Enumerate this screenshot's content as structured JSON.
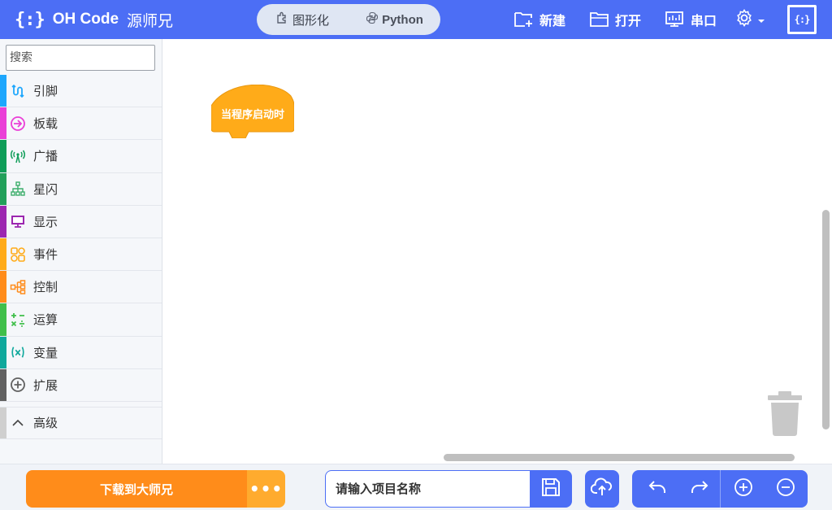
{
  "brand": {
    "icon_text": "{:}",
    "name": "OH Code",
    "name_cn": "源师兄"
  },
  "mode_tabs": [
    {
      "label": "图形化",
      "icon": "puzzle-icon"
    },
    {
      "label": "Python",
      "icon": "python-icon"
    }
  ],
  "top_actions": {
    "new": {
      "label": "新建",
      "icon": "new-file-icon"
    },
    "open": {
      "label": "打开",
      "icon": "folder-icon"
    },
    "serial": {
      "label": "串口",
      "icon": "serial-monitor-icon"
    },
    "settings": {
      "icon": "gear-icon"
    }
  },
  "sidebar": {
    "search": {
      "placeholder": "搜索",
      "value": ""
    },
    "categories": [
      {
        "label": "引脚",
        "color": "#1ea7fd",
        "icon": "pin-icon"
      },
      {
        "label": "板载",
        "color": "#ea3fd7",
        "icon": "board-icon"
      },
      {
        "label": "广播",
        "color": "#0f9d58",
        "icon": "broadcast-icon"
      },
      {
        "label": "星闪",
        "color": "#22a05a",
        "icon": "network-icon"
      },
      {
        "label": "显示",
        "color": "#9c27b0",
        "icon": "display-icon"
      },
      {
        "label": "事件",
        "color": "#ffab19",
        "icon": "event-icon"
      },
      {
        "label": "控制",
        "color": "#ff8c1a",
        "icon": "control-icon"
      },
      {
        "label": "运算",
        "color": "#40bf4a",
        "icon": "operators-icon"
      },
      {
        "label": "变量",
        "color": "#0fa89c",
        "icon": "variable-icon"
      },
      {
        "label": "扩展",
        "color": "#616161",
        "icon": "extension-icon"
      }
    ],
    "advanced": {
      "label": "高级",
      "icon": "chevron-up-icon",
      "color": "#c8c8c8"
    }
  },
  "canvas": {
    "hat_block": {
      "label": "当程序启动时",
      "color": "#ffab19"
    },
    "trash": {
      "icon": "trash-icon"
    }
  },
  "bottom": {
    "download_label": "下载到大师兄",
    "more_label": "•••",
    "project_name": {
      "placeholder": "请输入项目名称",
      "value": ""
    },
    "save_icon": "save-icon",
    "upload_icon": "cloud-upload-icon",
    "tools": [
      "undo-icon",
      "redo-icon",
      "zoom-in-icon",
      "zoom-out-icon"
    ]
  },
  "colors": {
    "accent": "#4c6ef5",
    "orange": "#ff8c1a",
    "orange_light": "#ffab2e"
  }
}
